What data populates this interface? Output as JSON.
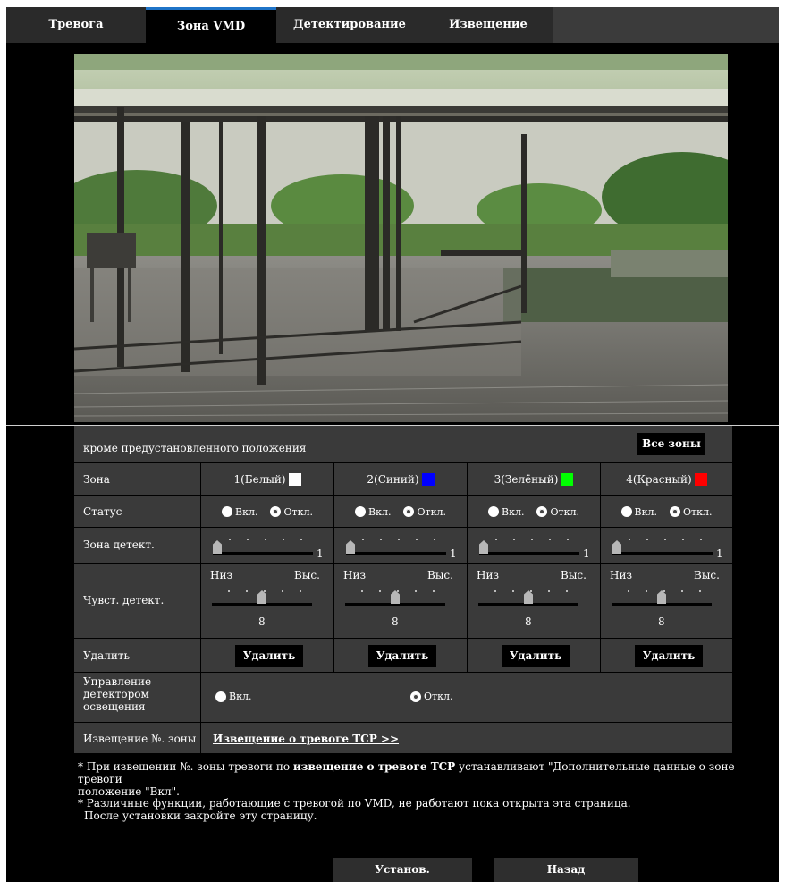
{
  "tabs": [
    "Тревога",
    "Зона VMD",
    "Детектирование звука",
    "Извещение"
  ],
  "active_tab": 1,
  "panel": {
    "header_text": "кроме предустановленного положения",
    "all_zones_button": "Все зоны",
    "row_labels": {
      "zone": "Зона",
      "status": "Статус",
      "detect_area": "Зона детект.",
      "sensitivity": "Чувст. детект.",
      "delete": "Удалить",
      "light_control": "Управление детектором освещения",
      "notification": "Извещение №. зоны"
    },
    "zones": [
      {
        "name": "1(Белый)",
        "color": "#ffffff"
      },
      {
        "name": "2(Синий)",
        "color": "#0000ff"
      },
      {
        "name": "3(Зелёный)",
        "color": "#00ff00"
      },
      {
        "name": "4(Красный)",
        "color": "#ff0000"
      }
    ],
    "status_on": "Вкл.",
    "status_off": "Откл.",
    "status_selected": "off",
    "detect_area_value": "1",
    "sens_low": "Низ",
    "sens_high": "Выс.",
    "sens_value": "8",
    "delete_button": "Удалить",
    "light_on": "Вкл.",
    "light_off": "Откл.",
    "light_selected": "off",
    "notification_link": "Извещение о тревоге TCP >>"
  },
  "notes": {
    "note1_prefix": "* При извещении №. зоны тревоги по ",
    "note1_bold": "извещение о тревоге TCP",
    "note1_rest": " устанавливают \"Дополнительные данные о зоне тревоги",
    "note1_line2": "положение \"Вкл\".",
    "note2_line1": "* Различные функции, работающие с тревогой по VMD, не работают пока открыта эта страница.",
    "note2_line2": "После установки закройте эту страницу."
  },
  "footer": {
    "set_button": "Установ.",
    "back_button": "Назад"
  }
}
